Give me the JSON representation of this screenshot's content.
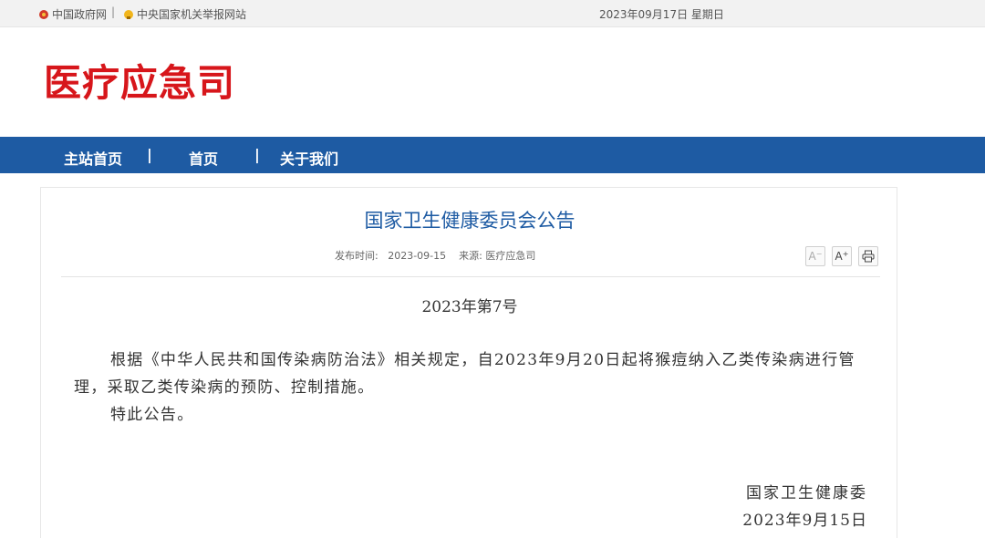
{
  "topbar": {
    "gov_link": "中国政府网",
    "separator": "|",
    "report_link": "中央国家机关举报网站",
    "date": "2023年09月17日 星期日"
  },
  "header": {
    "site_name": "医疗应急司"
  },
  "nav": {
    "items": [
      "主站首页",
      "首页",
      "关于我们"
    ],
    "divider": "|"
  },
  "article": {
    "title": "国家卫生健康委员会公告",
    "publish_label": "发布时间:",
    "publish_date": "2023-09-15",
    "source_label": "来源:",
    "source": "医疗应急司",
    "tools": {
      "font_smaller": "A",
      "font_larger": "A",
      "print_icon": "printer-icon"
    },
    "doc_number": "2023年第7号",
    "body": "根据《中华人民共和国传染病防治法》相关规定，自2023年9月20日起将猴痘纳入乙类传染病进行管理，采取乙类传染病的预防、控制措施。",
    "notice": "特此公告。",
    "signature_org": "国家卫生健康委",
    "signature_date": "2023年9月15日"
  },
  "colors": {
    "brand_red": "#d7161b",
    "nav_blue": "#1e5ba3",
    "title_blue": "#1e5ba3"
  }
}
